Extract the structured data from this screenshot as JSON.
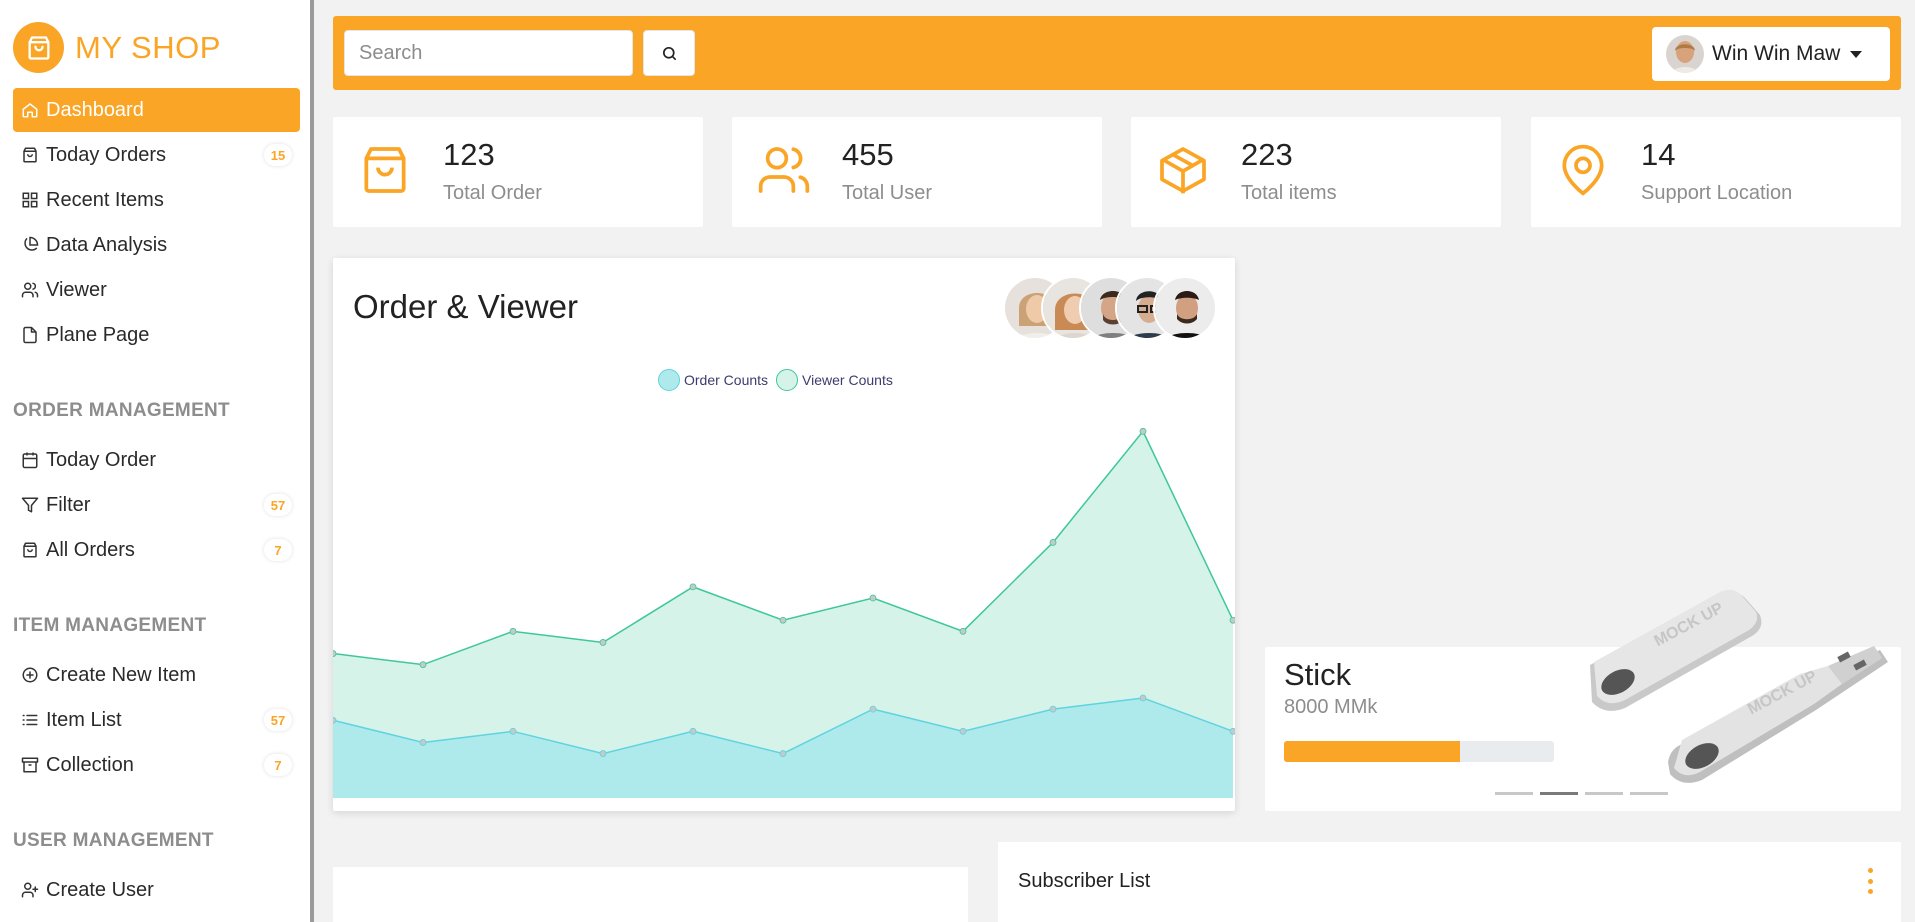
{
  "brand": {
    "name": "MY SHOP"
  },
  "sidebar": {
    "main": [
      {
        "label": "Dashboard",
        "icon": "home-icon",
        "active": true
      },
      {
        "label": "Today Orders",
        "icon": "bag-icon",
        "badge": "15"
      },
      {
        "label": "Recent Items",
        "icon": "grid-icon"
      },
      {
        "label": "Data Analysis",
        "icon": "pie-chart-icon"
      },
      {
        "label": "Viewer",
        "icon": "users-icon"
      },
      {
        "label": "Plane Page",
        "icon": "file-icon"
      }
    ],
    "order_management": {
      "title": "ORDER MANAGEMENT",
      "items": [
        {
          "label": "Today Order",
          "icon": "calendar-icon"
        },
        {
          "label": "Filter",
          "icon": "filter-icon",
          "badge": "57"
        },
        {
          "label": "All Orders",
          "icon": "bag-icon",
          "badge": "7"
        }
      ]
    },
    "item_management": {
      "title": "ITEM MANAGEMENT",
      "items": [
        {
          "label": "Create New Item",
          "icon": "plus-circle-icon"
        },
        {
          "label": "Item List",
          "icon": "list-icon",
          "badge": "57"
        },
        {
          "label": "Collection",
          "icon": "archive-icon",
          "badge": "7"
        }
      ]
    },
    "user_management": {
      "title": "USER MANAGEMENT",
      "items": [
        {
          "label": "Create User",
          "icon": "user-plus-icon"
        }
      ]
    }
  },
  "topbar": {
    "search_placeholder": "Search",
    "user_name": "Win Win Maw"
  },
  "stats": [
    {
      "value": "123",
      "label": "Total Order",
      "icon": "bag-icon"
    },
    {
      "value": "455",
      "label": "Total User",
      "icon": "users-icon"
    },
    {
      "value": "223",
      "label": "Total items",
      "icon": "box-icon"
    },
    {
      "value": "14",
      "label": "Support Location",
      "icon": "map-pin-icon"
    }
  ],
  "chart_card": {
    "title": "Order & Viewer"
  },
  "chart_data": {
    "type": "area",
    "x": [
      "1",
      "2",
      "3",
      "4",
      "5",
      "6",
      "7",
      "8",
      "9",
      "10",
      "11",
      "12"
    ],
    "series": [
      {
        "name": "Order Counts",
        "color": "#5fd3e0",
        "fill": "#aeeaeb",
        "values": [
          7,
          5,
          6,
          4,
          6,
          4,
          8,
          6,
          8,
          9,
          6
        ]
      },
      {
        "name": "Viewer Counts",
        "color": "#3ec799",
        "fill": "#d5f3e9",
        "values": [
          13,
          12,
          15,
          14,
          19,
          16,
          18,
          15,
          23,
          33,
          16
        ]
      }
    ],
    "ylim": [
      0,
      36
    ],
    "legend": "top-center",
    "grid": false
  },
  "product": {
    "name": "Stick",
    "price": "8000 MMk",
    "progress": 0.65,
    "image_text": "MOCK UP"
  },
  "subscriber": {
    "title": "Subscriber List"
  },
  "colors": {
    "accent": "#faa526"
  }
}
